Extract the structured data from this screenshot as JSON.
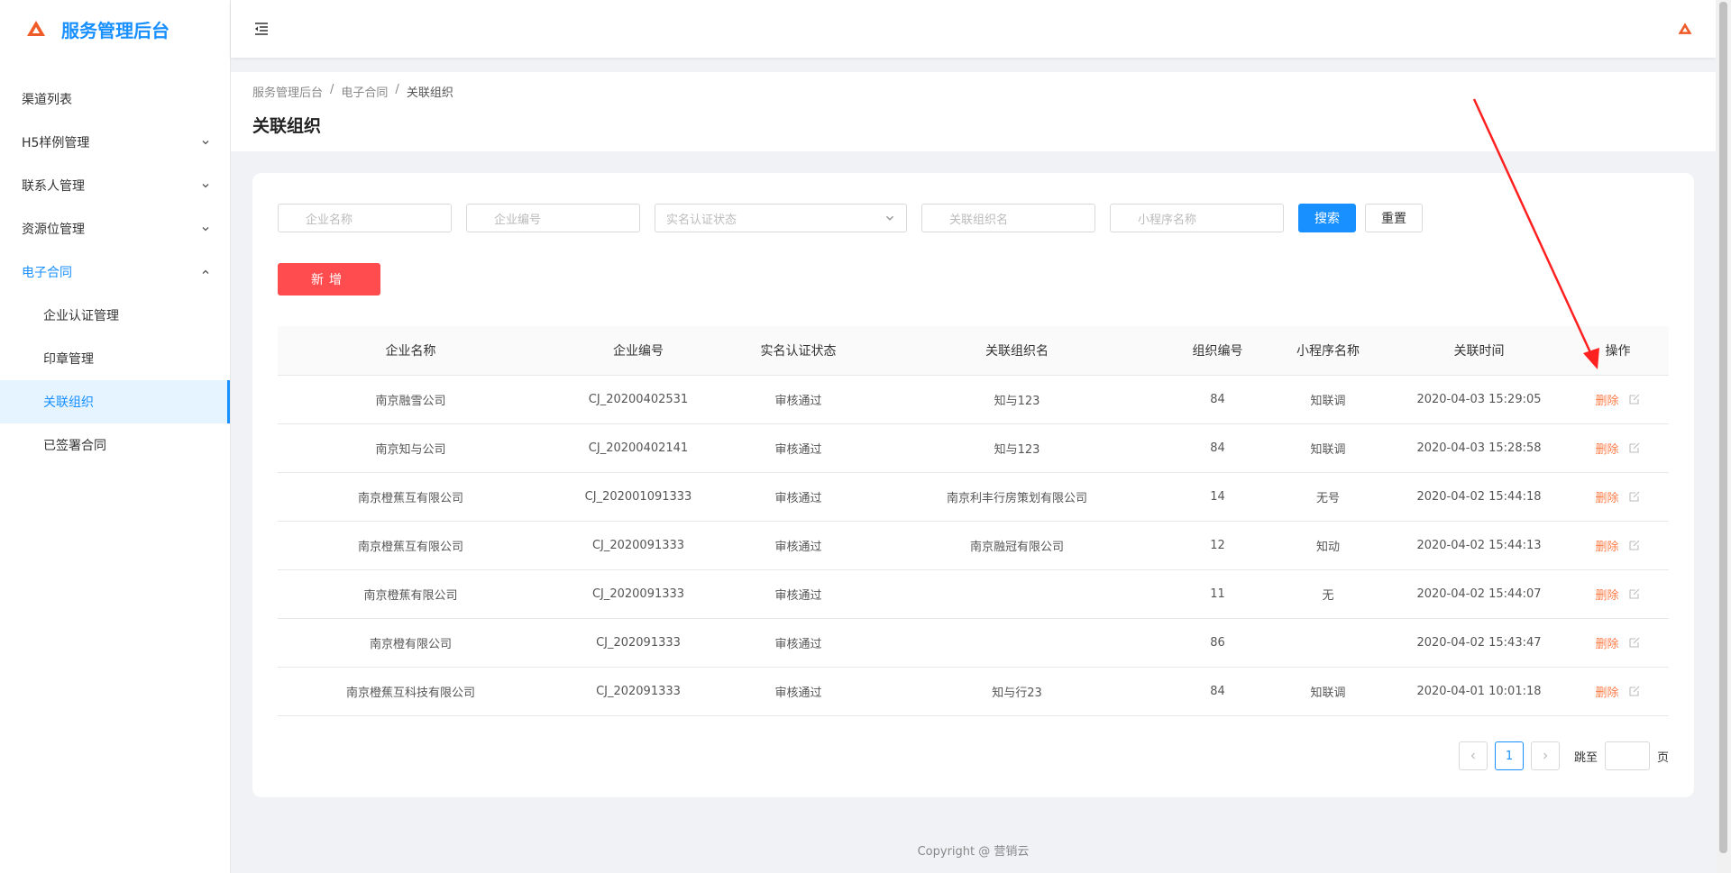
{
  "app": {
    "title": "服务管理后台",
    "accent": "#1890ff"
  },
  "sidebar": {
    "items": [
      {
        "label": "渠道列表"
      },
      {
        "label": "H5样例管理"
      },
      {
        "label": "联系人管理"
      },
      {
        "label": "资源位管理"
      },
      {
        "label": "电子合同"
      },
      {
        "label": "企业认证管理"
      },
      {
        "label": "印章管理"
      },
      {
        "label": "关联组织"
      },
      {
        "label": "已签署合同"
      }
    ]
  },
  "breadcrumb": [
    "服务管理后台",
    "电子合同",
    "关联组织"
  ],
  "page": {
    "title": "关联组织"
  },
  "filters": {
    "company_name": "企业名称",
    "company_code": "企业编号",
    "auth_status": "实名认证状态",
    "org_name": "关联组织名",
    "miniapp_name": "小程序名称",
    "search_label": "搜索",
    "reset_label": "重置",
    "add_label": "新增"
  },
  "table": {
    "columns": [
      "企业名称",
      "企业编号",
      "实名认证状态",
      "关联组织名",
      "组织编号",
      "小程序名称",
      "关联时间",
      "操作"
    ],
    "rows": [
      {
        "company": "南京融雪公司",
        "code": "CJ_20200402531",
        "status": "审核通过",
        "org": "知与123",
        "org_no": "84",
        "miniapp": "知联调",
        "time": "2020-04-03 15:29:05"
      },
      {
        "company": "南京知与公司",
        "code": "CJ_20200402141",
        "status": "审核通过",
        "org": "知与123",
        "org_no": "84",
        "miniapp": "知联调",
        "time": "2020-04-03 15:28:58"
      },
      {
        "company": "南京橙蕉互有限公司",
        "code": "CJ_202001091333",
        "status": "审核通过",
        "org": "南京利丰行房策划有限公司",
        "org_no": "14",
        "miniapp": "无号",
        "time": "2020-04-02 15:44:18"
      },
      {
        "company": "南京橙蕉互有限公司",
        "code": "CJ_2020091333",
        "status": "审核通过",
        "org": "南京融冠有限公司",
        "org_no": "12",
        "miniapp": "知动",
        "time": "2020-04-02 15:44:13"
      },
      {
        "company": "南京橙蕉有限公司",
        "code": "CJ_2020091333",
        "status": "审核通过",
        "org": "",
        "org_no": "11",
        "miniapp": "无",
        "time": "2020-04-02 15:44:07"
      },
      {
        "company": "南京橙有限公司",
        "code": "CJ_202091333",
        "status": "审核通过",
        "org": "",
        "org_no": "86",
        "miniapp": "",
        "time": "2020-04-02 15:43:47"
      },
      {
        "company": "南京橙蕉互科技有限公司",
        "code": "CJ_202091333",
        "status": "审核通过",
        "org": "知与行23",
        "org_no": "84",
        "miniapp": "知联调",
        "time": "2020-04-01 10:01:18"
      }
    ],
    "delete_label": "删除"
  },
  "pagination": {
    "current": "1",
    "jump_label": "跳至",
    "page_suffix": "页"
  },
  "footer": {
    "copyright": "Copyright @ 营销云"
  }
}
